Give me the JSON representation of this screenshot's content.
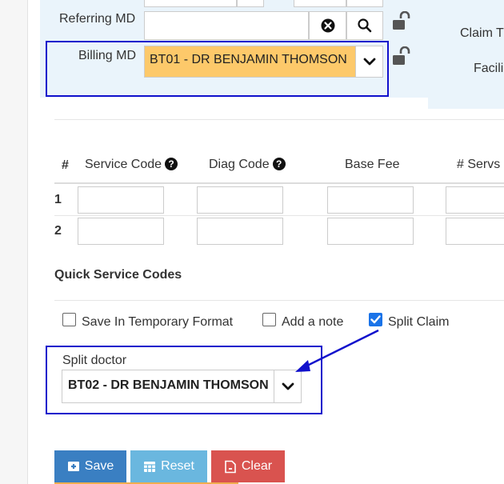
{
  "referring_md": {
    "label": "Referring MD",
    "value": ""
  },
  "billing_md": {
    "label": "Billing MD",
    "selected": "BT01 - DR BENJAMIN THOMSON"
  },
  "right_labels": {
    "claim": "Claim T",
    "facility": "Facili"
  },
  "service_table": {
    "headers": [
      "#",
      "Service Code",
      "Diag Code",
      "Base Fee",
      "# Servs"
    ],
    "rows": [
      {
        "num": "1"
      },
      {
        "num": "2"
      }
    ]
  },
  "quick_service_codes": {
    "title": "Quick Service Codes"
  },
  "options": {
    "save_temp": {
      "label": "Save In Temporary Format",
      "checked": false
    },
    "add_note": {
      "label": "Add a note",
      "checked": false
    },
    "split_claim": {
      "label": "Split Claim",
      "checked": true
    }
  },
  "split_doctor": {
    "label": "Split doctor",
    "selected": "BT02 - DR BENJAMIN THOMSON"
  },
  "buttons": {
    "save": "Save",
    "reset": "Reset",
    "clear": "Clear"
  },
  "colors": {
    "save": "#3a7fc2",
    "reset": "#6ab7df",
    "clear": "#d9534f",
    "billing_highlight": "#fdc96a",
    "annotation": "#1111cc"
  }
}
